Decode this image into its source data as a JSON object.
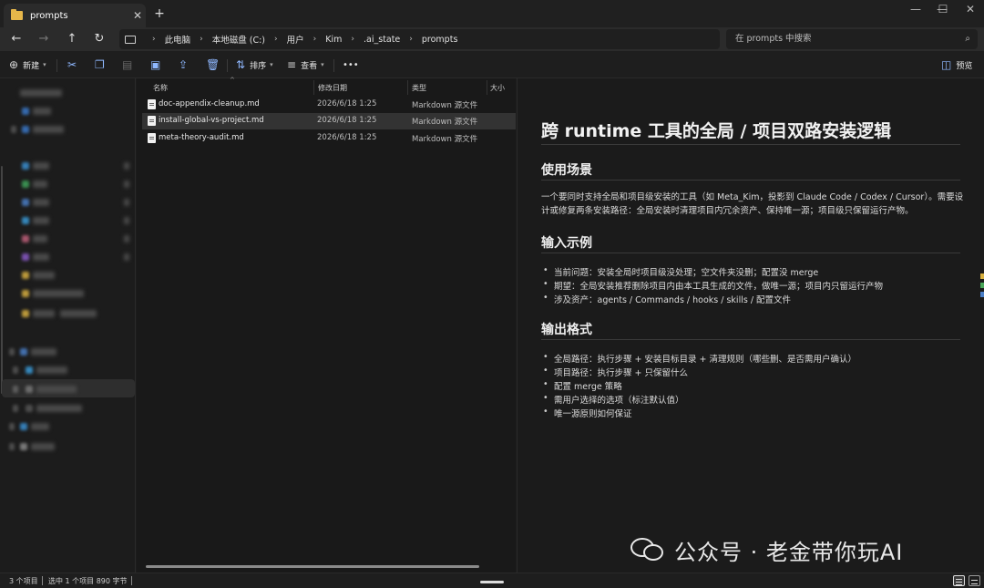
{
  "tab": {
    "title": "prompts",
    "close": "✕",
    "new": "+"
  },
  "window_controls": {
    "minimize": "—",
    "maximize": "☐",
    "close": "✕"
  },
  "nav": {
    "back": "←",
    "forward": "→",
    "up": "↑",
    "refresh": "↻",
    "breadcrumb": [
      "此电脑",
      "本地磁盘 (C:)",
      "用户",
      "Kim",
      ".ai_state",
      "prompts"
    ],
    "search_placeholder": "在 prompts 中搜索"
  },
  "toolbar": {
    "new_label": "新建",
    "sort_label": "排序",
    "view_label": "查看",
    "more": "•••",
    "preview_label": "预览"
  },
  "columns": {
    "name": "名称",
    "modified": "修改日期",
    "type": "类型",
    "size": "大小"
  },
  "files": [
    {
      "name": "doc-appendix-cleanup.md",
      "modified": "2026/6/18 1:25",
      "type": "Markdown 源文件",
      "selected": false
    },
    {
      "name": "install-global-vs-project.md",
      "modified": "2026/6/18 1:25",
      "type": "Markdown 源文件",
      "selected": true
    },
    {
      "name": "meta-theory-audit.md",
      "modified": "2026/6/18 1:25",
      "type": "Markdown 源文件",
      "selected": false
    }
  ],
  "preview": {
    "title": "跨 runtime 工具的全局 / 项目双路安装逻辑",
    "sections": [
      {
        "heading": "使用场景",
        "paragraph": "一个要同时支持全局和项目级安装的工具（如 Meta_Kim，投影到 Claude Code / Codex / Cursor）。需要设计或修复两条安装路径：全局安装时清理项目内冗余资产、保持唯一源；项目级只保留运行产物。"
      },
      {
        "heading": "输入示例",
        "items": [
          "当前问题：安装全局时项目级没处理；空文件夹没删；配置没 merge",
          "期望：全局安装推荐删除项目内由本工具生成的文件，做唯一源；项目内只留运行产物",
          "涉及资产：agents / Commands / hooks / skills / 配置文件"
        ]
      },
      {
        "heading": "输出格式",
        "items": [
          "全局路径：执行步骤 + 安装目标目录 + 清理规则（哪些删、是否需用户确认）",
          "项目路径：执行步骤 + 只保留什么",
          "配置 merge 策略",
          "需用户选择的选项（标注默认值）",
          "唯一源原则如何保证"
        ]
      }
    ]
  },
  "watermark": "公众号 · 老金带你玩AI",
  "status": {
    "count": "3 个项目",
    "selection": "选中 1 个项目  890 字节"
  },
  "colors": {
    "folder": "#e7b74a",
    "accent": "#8fb8ff",
    "background": "#1c1c1c"
  }
}
